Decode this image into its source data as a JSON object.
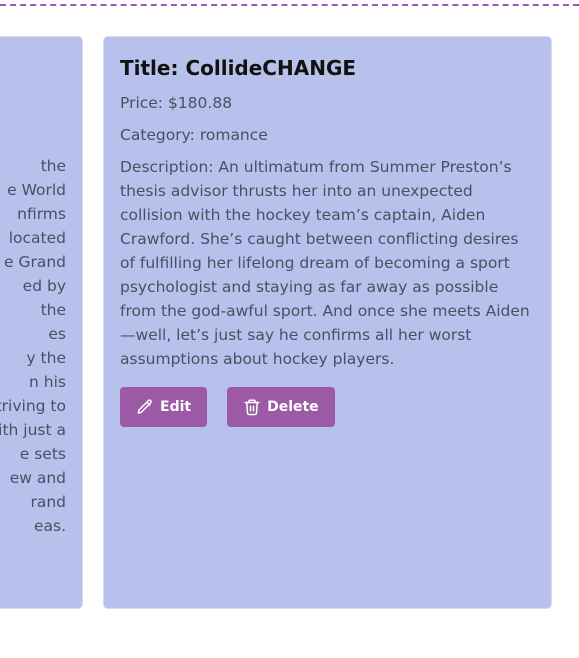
{
  "left_card": {
    "lines": [
      "the",
      "e World",
      "nfirms",
      "located",
      "e Grand",
      "ed by",
      "the",
      "es",
      "y the",
      "n his",
      "triving to",
      "ith just a",
      "e sets",
      "ew and",
      "rand",
      "eas."
    ]
  },
  "main_card": {
    "title": "Title: CollideCHANGE",
    "price": "Price: $180.88",
    "category": "Category: romance",
    "description": "Description: An ultimatum from Summer Preston’s thesis advisor thrusts her into an unexpected collision with the hockey team’s captain, Aiden Crawford. She’s caught between conflicting desires of fulfilling her lifelong dream of becoming a sport psychologist and staying as far away as possible from the god-awful sport. And once she meets Aiden—well, let’s just say he confirms all her worst assumptions about hockey players.",
    "edit_label": "Edit",
    "delete_label": "Delete",
    "edit_icon": "pencil-icon",
    "delete_icon": "trash-icon"
  },
  "colors": {
    "card_background": "#b8c1eb",
    "button_background": "#9b59a6",
    "button_text": "#ffffff",
    "divider": "#9b59b6"
  }
}
